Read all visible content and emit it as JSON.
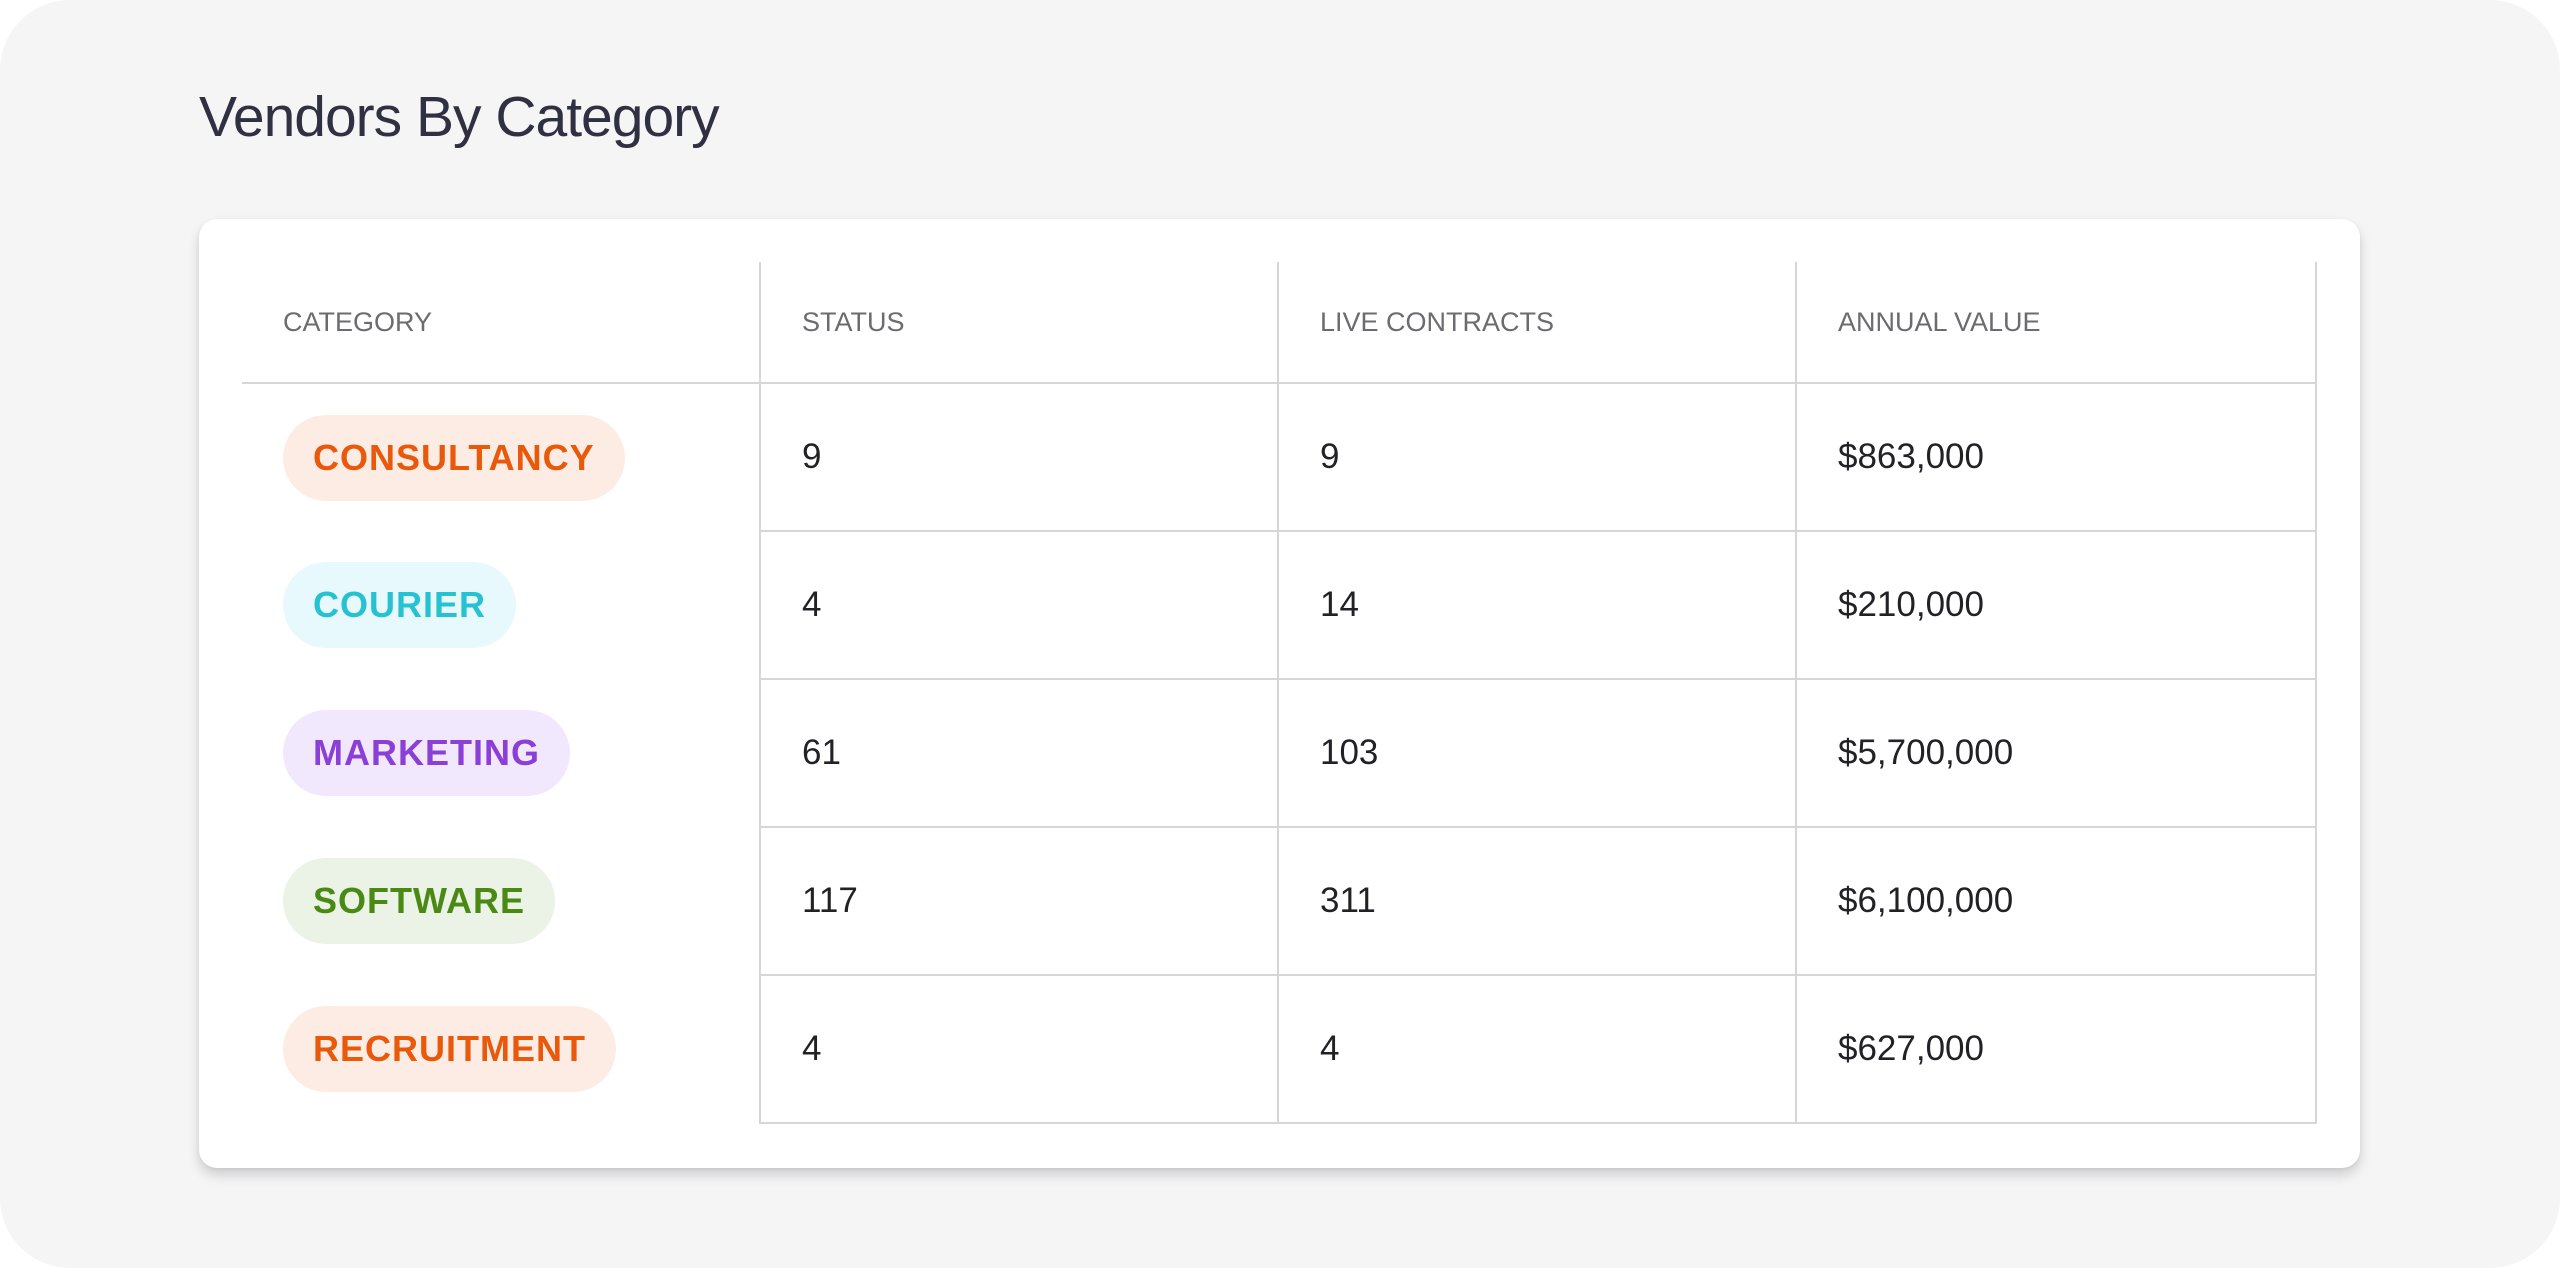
{
  "page": {
    "title": "Vendors By Category"
  },
  "table": {
    "columns": [
      "CATEGORY",
      "STATUS",
      "LIVE CONTRACTS",
      "ANNUAL VALUE"
    ],
    "rows": [
      {
        "category": "CONSULTANCY",
        "chip_color": "#e8590c",
        "chip_bg": "#fdece3",
        "status": "9",
        "live_contracts": "9",
        "annual_value": "$863,000"
      },
      {
        "category": "COURIER",
        "chip_color": "#26c2d2",
        "chip_bg": "#e7f9fc",
        "status": "4",
        "live_contracts": "14",
        "annual_value": "$210,000"
      },
      {
        "category": "MARKETING",
        "chip_color": "#8a3fd6",
        "chip_bg": "#f2e8fd",
        "status": "61",
        "live_contracts": "103",
        "annual_value": "$5,700,000"
      },
      {
        "category": "SOFTWARE",
        "chip_color": "#4a8a14",
        "chip_bg": "#ebf2e6",
        "status": "117",
        "live_contracts": "311",
        "annual_value": "$6,100,000"
      },
      {
        "category": "RECRUITMENT",
        "chip_color": "#e8590c",
        "chip_bg": "#fdece3",
        "status": "4",
        "live_contracts": "4",
        "annual_value": "$627,000"
      }
    ]
  }
}
